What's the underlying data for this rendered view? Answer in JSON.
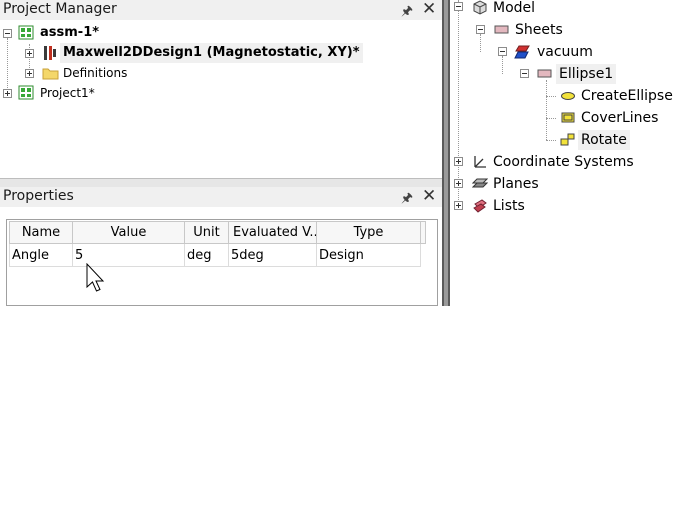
{
  "project_manager": {
    "title": "Project Manager",
    "items": [
      {
        "label": "assm-1*"
      },
      {
        "label": "Maxwell2DDesign1 (Magnetostatic, XY)*"
      },
      {
        "label": "Definitions"
      },
      {
        "label": "Project1*"
      }
    ]
  },
  "properties": {
    "title": "Properties",
    "columns": [
      "Name",
      "Value",
      "Unit",
      "Evaluated V...",
      "Type"
    ],
    "rows": [
      {
        "name": "Angle",
        "value": "5",
        "unit": "deg",
        "evaluated": "5deg",
        "type": "Design"
      }
    ]
  },
  "model_tree": {
    "items": [
      {
        "label": "Model"
      },
      {
        "label": "Sheets"
      },
      {
        "label": "vacuum"
      },
      {
        "label": "Ellipse1"
      },
      {
        "label": "CreateEllipse"
      },
      {
        "label": "CoverLines"
      },
      {
        "label": "Rotate"
      },
      {
        "label": "Coordinate Systems"
      },
      {
        "label": "Planes"
      },
      {
        "label": "Lists"
      }
    ]
  },
  "icons": {
    "pin": "pin-icon",
    "close": "close-icon",
    "cursor": "mouse-cursor-icon"
  }
}
